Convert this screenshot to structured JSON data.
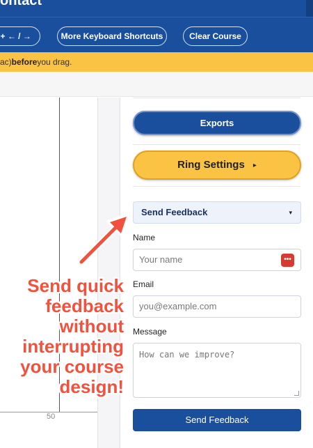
{
  "header": {
    "title": "ontact"
  },
  "toolbar": {
    "shortcut_button": "t + ← / →",
    "more_shortcuts_button": "More Keyboard Shortcuts",
    "clear_course_button": "Clear Course"
  },
  "warning": {
    "prefix": "ac)",
    "bold": "before",
    "suffix": "you drag."
  },
  "chart_axis": {
    "tick_label": "50"
  },
  "sidebar": {
    "exports_button": "Exports",
    "ring_settings_button": "Ring Settings",
    "ring_settings_caret": "▸",
    "feedback": {
      "toggle_label": "Send Feedback",
      "toggle_chevron": "▾",
      "name_label": "Name",
      "name_placeholder": "Your name",
      "password_manager_icon": "•••",
      "email_label": "Email",
      "email_placeholder": "you@example.com",
      "message_label": "Message",
      "message_placeholder": "How can we improve?",
      "submit_button": "Send Feedback"
    }
  },
  "annotation": {
    "text": "Send quick\nfeedback\nwithout\ninterrupting\nyour course\ndesign!",
    "color": "#f2513d"
  },
  "colors": {
    "brand_blue": "#1a4f9e",
    "accent_yellow": "#fbc344"
  }
}
